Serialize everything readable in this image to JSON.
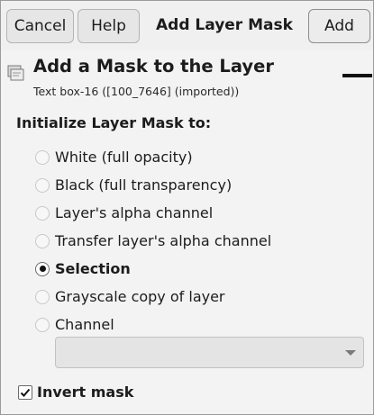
{
  "header": {
    "cancel_label": "Cancel",
    "help_label": "Help",
    "title": "Add Layer Mask",
    "add_label": "Add"
  },
  "panel": {
    "heading": "Add a Mask to the Layer",
    "layer_name": "Text box-16 ([100_7646] (imported))",
    "section_label": "Initialize Layer Mask to:"
  },
  "options": [
    {
      "label": "White (full opacity)",
      "checked": false
    },
    {
      "label": "Black (full transparency)",
      "checked": false
    },
    {
      "label": "Layer's alpha channel",
      "checked": false
    },
    {
      "label": "Transfer layer's alpha channel",
      "checked": false
    },
    {
      "label": "Selection",
      "checked": true
    },
    {
      "label": "Grayscale copy of layer",
      "checked": false
    },
    {
      "label": "Channel",
      "checked": false
    }
  ],
  "channel_select": {
    "value": "",
    "enabled": false
  },
  "invert_mask": {
    "label": "Invert mask",
    "checked": true
  },
  "icons": {
    "layer": "layer-mask-icon",
    "dropdown": "chevron-down-icon",
    "check": "checkmark-icon"
  }
}
